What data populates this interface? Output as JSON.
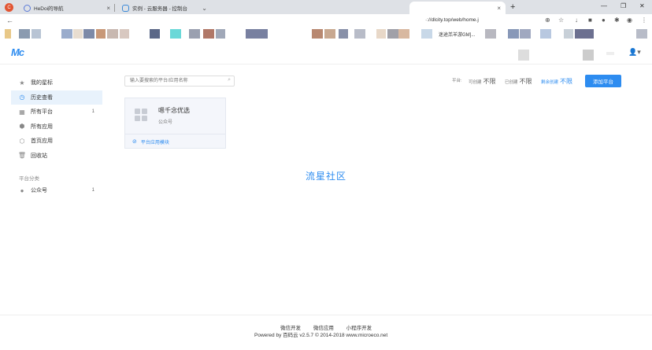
{
  "browser": {
    "tabs": [
      {
        "title": "HeDoi的导航"
      },
      {
        "title": "实例 - 云服务器 - 控制台"
      },
      {
        "title": ""
      }
    ],
    "url": "·://dlcity.top/web/home.j",
    "bookmark_text": "迷途羔羊游GM]...",
    "window_controls": [
      "—",
      "❐",
      "✕"
    ]
  },
  "header": {
    "logo": "Mc"
  },
  "sidebar": {
    "items": [
      {
        "label": "我的星标",
        "icon": "star-icon",
        "count": ""
      },
      {
        "label": "历史查看",
        "icon": "clock-icon",
        "count": ""
      },
      {
        "label": "所有平台",
        "icon": "grid-icon",
        "count": "1"
      },
      {
        "label": "所有应用",
        "icon": "apps-icon",
        "count": ""
      },
      {
        "label": "首页应用",
        "icon": "home-cube-icon",
        "count": ""
      },
      {
        "label": "回收站",
        "icon": "trash-icon",
        "count": ""
      }
    ],
    "section_heading": "平台分类",
    "categories": [
      {
        "label": "公众号",
        "icon": "wechat-icon",
        "count": "1"
      }
    ]
  },
  "toolbar": {
    "search_placeholder": "输入要搜索的平台/应用名称",
    "quota_label": "平台:",
    "quotas": [
      {
        "label": "可创建",
        "value": "不限"
      },
      {
        "label": "已创建",
        "value": "不限"
      },
      {
        "label": "剩余创建",
        "value": "不限"
      }
    ],
    "add_button": "添加平台"
  },
  "card": {
    "name": "嗯千念优选",
    "type": "公众号",
    "footer_link": "平台应用模块"
  },
  "center_text": "流星社区",
  "footer": {
    "links": [
      "微信开发",
      "微信应用",
      "小程序开发"
    ],
    "copyright": "Powered by 百码云 v2.5.7 © 2014-2018 www.microeco.net"
  },
  "colors": {
    "accent": "#2d8cf0",
    "active_bg": "#e8f2fc"
  }
}
